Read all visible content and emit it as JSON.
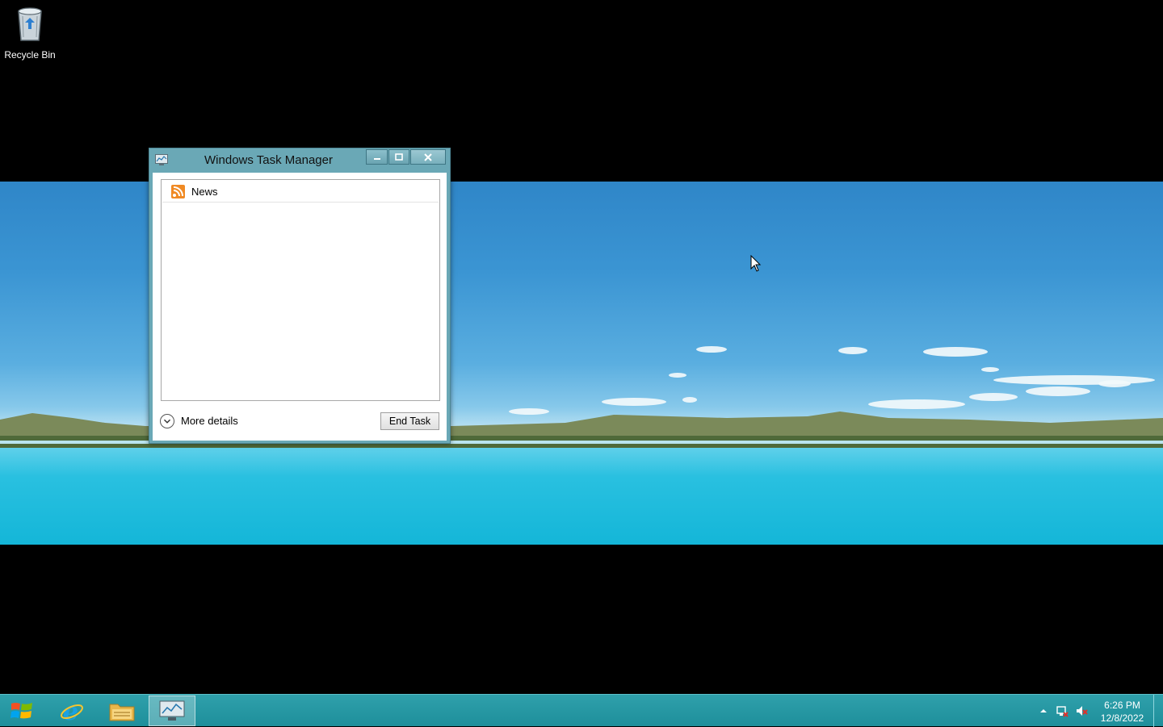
{
  "desktop": {
    "icons": [
      {
        "label": "Recycle Bin",
        "icon": "recycle-bin-icon"
      }
    ]
  },
  "task_manager": {
    "title": "Windows Task Manager",
    "caption_buttons": {
      "minimize": "minimize-icon",
      "maximize": "maximize-icon",
      "close": "close-icon"
    },
    "apps": [
      {
        "label": "News",
        "icon": "rss-news-icon"
      }
    ],
    "more_details_label": "More details",
    "end_task_label": "End Task"
  },
  "taskbar": {
    "pinned": [
      {
        "name": "start-button",
        "icon": "windows-logo-icon"
      },
      {
        "name": "internet-explorer",
        "icon": "ie-icon"
      },
      {
        "name": "file-explorer",
        "icon": "folder-icon"
      },
      {
        "name": "task-manager",
        "icon": "task-manager-icon",
        "active": true
      }
    ],
    "tray_icons": [
      "show-hidden-icons-icon",
      "network-icon",
      "volume-muted-icon"
    ],
    "clock": {
      "time": "6:26 PM",
      "date": "12/8/2022"
    }
  },
  "colors": {
    "taskbar": "#1e8f9b",
    "window_frame": "#6aa8b6",
    "wallpaper_sky": "#3b95d3",
    "wallpaper_water": "#14b6d8"
  }
}
